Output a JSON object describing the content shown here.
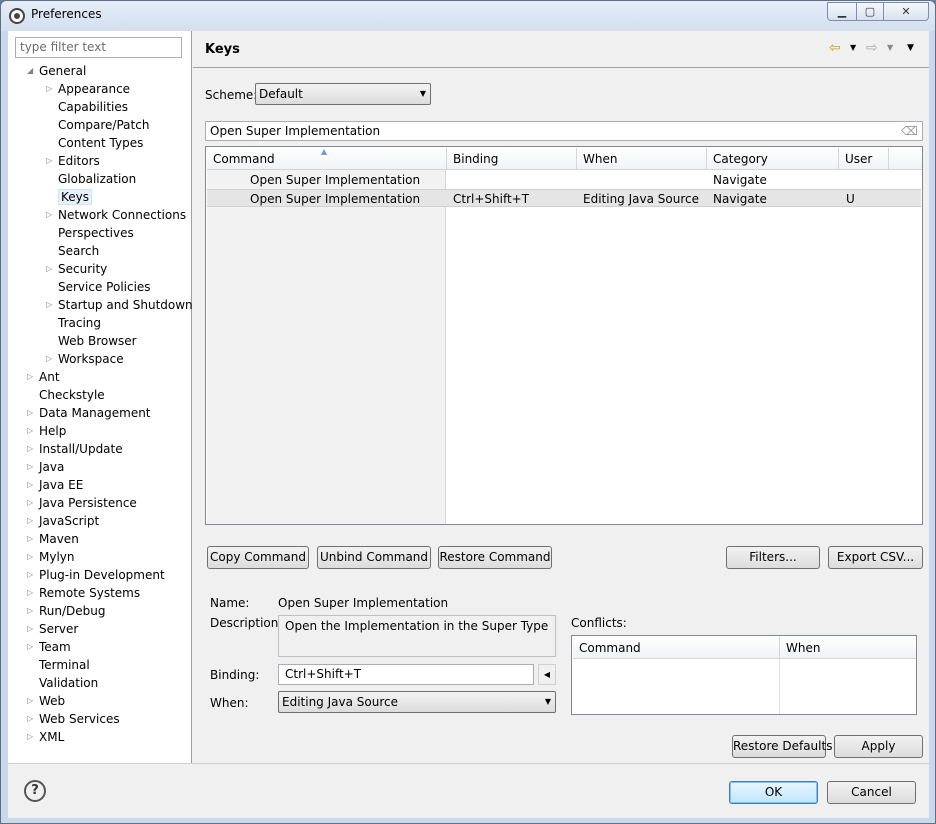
{
  "window": {
    "title": "Preferences"
  },
  "filter": {
    "placeholder": "type filter text"
  },
  "tree": [
    {
      "label": "General",
      "indent": 0,
      "expanded": true
    },
    {
      "label": "Appearance",
      "indent": 1,
      "expander": true
    },
    {
      "label": "Capabilities",
      "indent": 1
    },
    {
      "label": "Compare/Patch",
      "indent": 1
    },
    {
      "label": "Content Types",
      "indent": 1
    },
    {
      "label": "Editors",
      "indent": 1,
      "expander": true
    },
    {
      "label": "Globalization",
      "indent": 1
    },
    {
      "label": "Keys",
      "indent": 1,
      "selected": true
    },
    {
      "label": "Network Connections",
      "indent": 1,
      "expander": true
    },
    {
      "label": "Perspectives",
      "indent": 1
    },
    {
      "label": "Search",
      "indent": 1
    },
    {
      "label": "Security",
      "indent": 1,
      "expander": true
    },
    {
      "label": "Service Policies",
      "indent": 1
    },
    {
      "label": "Startup and Shutdown",
      "indent": 1,
      "expander": true
    },
    {
      "label": "Tracing",
      "indent": 1
    },
    {
      "label": "Web Browser",
      "indent": 1
    },
    {
      "label": "Workspace",
      "indent": 1,
      "expander": true
    },
    {
      "label": "Ant",
      "indent": 0,
      "expander": true
    },
    {
      "label": "Checkstyle",
      "indent": 0
    },
    {
      "label": "Data Management",
      "indent": 0,
      "expander": true
    },
    {
      "label": "Help",
      "indent": 0,
      "expander": true
    },
    {
      "label": "Install/Update",
      "indent": 0,
      "expander": true
    },
    {
      "label": "Java",
      "indent": 0,
      "expander": true
    },
    {
      "label": "Java EE",
      "indent": 0,
      "expander": true
    },
    {
      "label": "Java Persistence",
      "indent": 0,
      "expander": true
    },
    {
      "label": "JavaScript",
      "indent": 0,
      "expander": true
    },
    {
      "label": "Maven",
      "indent": 0,
      "expander": true
    },
    {
      "label": "Mylyn",
      "indent": 0,
      "expander": true
    },
    {
      "label": "Plug-in Development",
      "indent": 0,
      "expander": true
    },
    {
      "label": "Remote Systems",
      "indent": 0,
      "expander": true
    },
    {
      "label": "Run/Debug",
      "indent": 0,
      "expander": true
    },
    {
      "label": "Server",
      "indent": 0,
      "expander": true
    },
    {
      "label": "Team",
      "indent": 0,
      "expander": true
    },
    {
      "label": "Terminal",
      "indent": 0
    },
    {
      "label": "Validation",
      "indent": 0
    },
    {
      "label": "Web",
      "indent": 0,
      "expander": true
    },
    {
      "label": "Web Services",
      "indent": 0,
      "expander": true
    },
    {
      "label": "XML",
      "indent": 0,
      "expander": true
    }
  ],
  "page": {
    "title": "Keys",
    "scheme_label": "Scheme:",
    "scheme_value": "Default",
    "search_value": "Open Super Implementation",
    "columns": [
      "Command",
      "Binding",
      "When",
      "Category",
      "User"
    ],
    "rows": [
      {
        "command": "Open Super Implementation",
        "binding": "",
        "when": "",
        "category": "Navigate",
        "user": ""
      },
      {
        "command": "Open Super Implementation",
        "binding": "Ctrl+Shift+T",
        "when": "Editing Java Source",
        "category": "Navigate",
        "user": "U",
        "selected": true
      }
    ],
    "buttons": {
      "copy": "Copy Command",
      "unbind": "Unbind Command",
      "restore": "Restore Command",
      "filters": "Filters...",
      "export": "Export CSV..."
    },
    "details": {
      "name_label": "Name:",
      "name_value": "Open Super Implementation",
      "description_label": "Description:",
      "description_value": "Open the Implementation in the Super Type",
      "binding_label": "Binding:",
      "binding_value": "Ctrl+Shift+T",
      "when_label": "When:",
      "when_value": "Editing Java Source"
    },
    "conflicts": {
      "label": "Conflicts:",
      "columns": [
        "Command",
        "When"
      ]
    },
    "restore_defaults": "Restore Defaults",
    "apply": "Apply"
  },
  "footer": {
    "ok": "OK",
    "cancel": "Cancel"
  },
  "icons": {
    "help": "?",
    "nav_back": "⇦",
    "nav_forward": "⇨"
  }
}
